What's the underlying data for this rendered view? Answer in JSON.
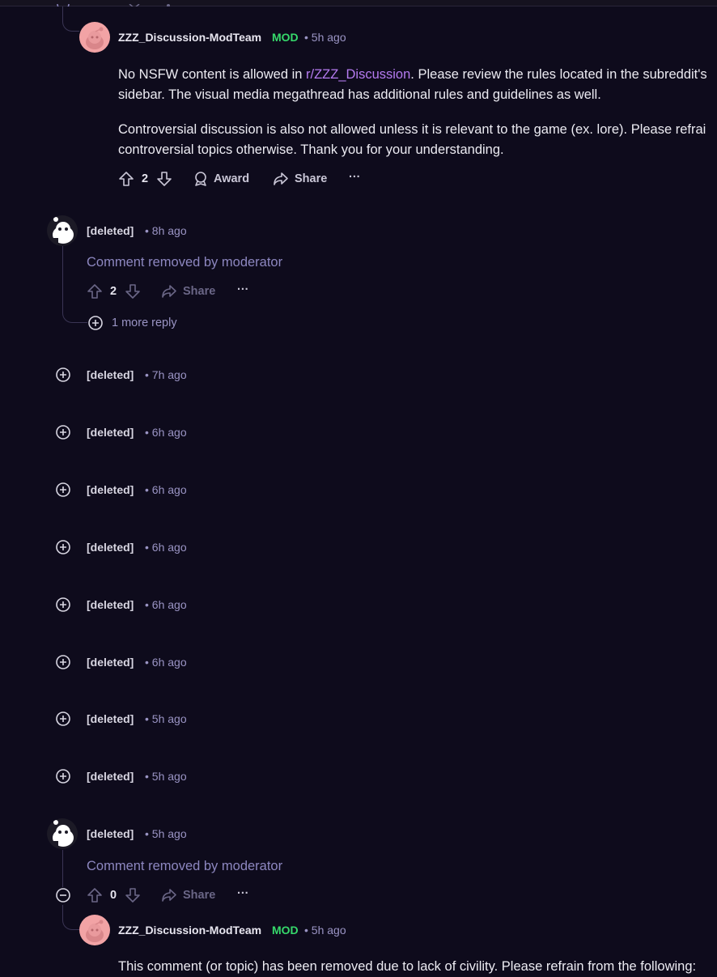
{
  "first_comment": {
    "author": "ZZZ_Discussion-ModTeam",
    "badge": "MOD",
    "time": "• 5h ago",
    "p1_start": "No NSFW content is allowed in ",
    "p1_link": "r/ZZZ_Discussion",
    "p1_end": ". Please review the rules located in the subreddit's",
    "p1_line2": "sidebar. The visual media megathread has additional rules and guidelines as well.",
    "p2_line1": "Controversial discussion is also not allowed unless it is relevant to the game (ex. lore). Please refrai",
    "p2_line2": "controversial topics otherwise. Thank you for your understanding.",
    "votes": "2",
    "award": "Award",
    "share": "Share",
    "more": "···"
  },
  "deleted_comment_1": {
    "author": "[deleted]",
    "time": "• 8h ago",
    "removed": "Comment removed by moderator",
    "votes": "2",
    "share": "Share",
    "more": "···",
    "more_replies": "1 more reply"
  },
  "collapsed": [
    {
      "author": "[deleted]",
      "time": "• 7h ago"
    },
    {
      "author": "[deleted]",
      "time": "• 6h ago"
    },
    {
      "author": "[deleted]",
      "time": "• 6h ago"
    },
    {
      "author": "[deleted]",
      "time": "• 6h ago"
    },
    {
      "author": "[deleted]",
      "time": "• 6h ago"
    },
    {
      "author": "[deleted]",
      "time": "• 6h ago"
    },
    {
      "author": "[deleted]",
      "time": "• 5h ago"
    },
    {
      "author": "[deleted]",
      "time": "• 5h ago"
    }
  ],
  "deleted_comment_2": {
    "author": "[deleted]",
    "time": "• 5h ago",
    "removed": "Comment removed by moderator",
    "votes": "0",
    "share": "Share",
    "more": "···"
  },
  "last_reply": {
    "author": "ZZZ_Discussion-ModTeam",
    "badge": "MOD",
    "time": "• 5h ago",
    "text": "This comment (or topic) has been removed due to lack of civility. Please refrain from the following:"
  }
}
